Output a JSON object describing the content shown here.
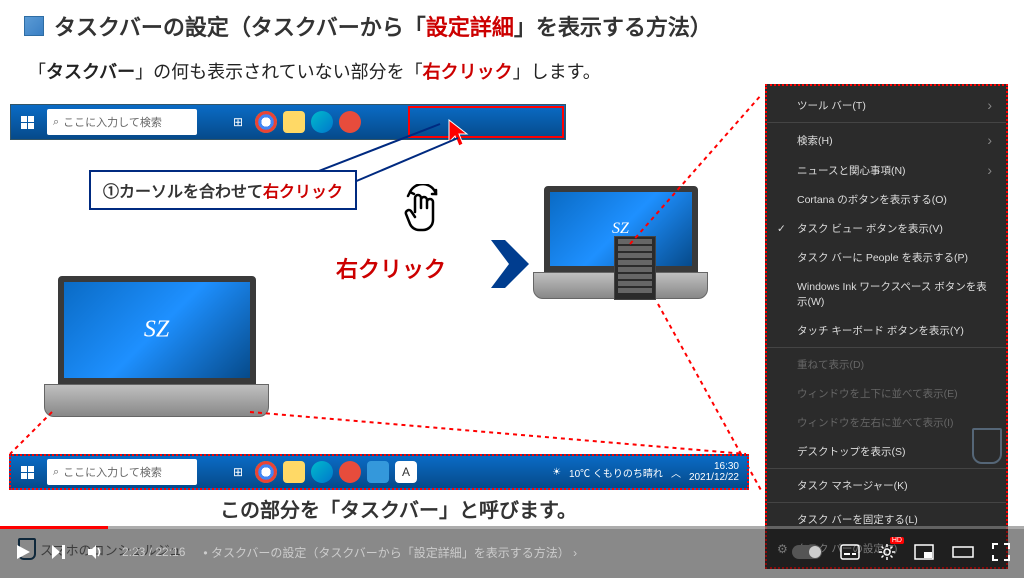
{
  "header": {
    "title_pre": "タスクバーの設定（タスクバーから「",
    "title_red": "設定詳細",
    "title_post": "」を表示する方法）"
  },
  "instruction": {
    "part1": "「",
    "bold1": "タスクバー",
    "part2": "」の何も表示されていない部分を「",
    "red": "右クリック",
    "part3": "」します。"
  },
  "taskbar": {
    "search_placeholder": "ここに入力して検索"
  },
  "callout": {
    "number": "①",
    "text": "カーソルを合わせて",
    "red": "右クリック"
  },
  "rightclick_label": "右クリック",
  "laptop_logo": "SZ",
  "bottom_caption_pre": "この部分を「",
  "bottom_caption_bold": "タスクバー",
  "bottom_caption_post": "」と呼びます。",
  "systray": {
    "weather": "10℃ くもりのち晴れ",
    "time": "16:30",
    "date": "2021/12/22"
  },
  "context_menu": [
    {
      "label": "ツール バー(T)",
      "sub": true
    },
    {
      "divider": true
    },
    {
      "label": "検索(H)",
      "sub": true
    },
    {
      "label": "ニュースと関心事項(N)",
      "sub": true
    },
    {
      "label": "Cortana のボタンを表示する(O)"
    },
    {
      "label": "タスク ビュー ボタンを表示(V)",
      "checked": true
    },
    {
      "label": "タスク バーに People を表示する(P)"
    },
    {
      "label": "Windows Ink ワークスペース ボタンを表示(W)"
    },
    {
      "label": "タッチ キーボード ボタンを表示(Y)"
    },
    {
      "divider": true
    },
    {
      "label": "重ねて表示(D)",
      "disabled": true
    },
    {
      "label": "ウィンドウを上下に並べて表示(E)",
      "disabled": true
    },
    {
      "label": "ウィンドウを左右に並べて表示(I)",
      "disabled": true
    },
    {
      "label": "デスクトップを表示(S)"
    },
    {
      "divider": true
    },
    {
      "label": "タスク マネージャー(K)"
    },
    {
      "divider": true
    },
    {
      "label": "タスク バーを固定する(L)"
    },
    {
      "label": "タスク バーの設定(T)",
      "gear": true
    }
  ],
  "player": {
    "current": "2:23",
    "total": "22:16",
    "chapter": "タスクバーの設定（タスクバーから「設定詳細」を表示する方法）"
  },
  "watermark": "スマホのコンシェルジュ"
}
